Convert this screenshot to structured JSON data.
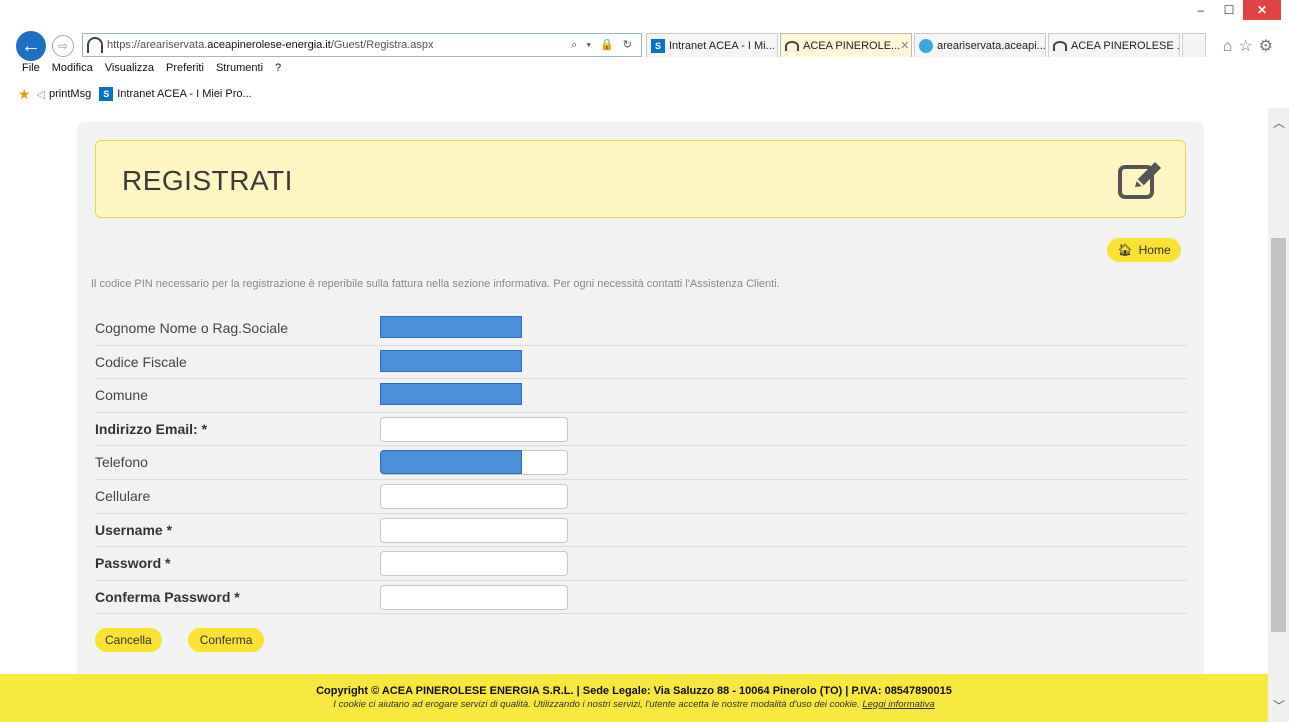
{
  "browser": {
    "url_prefix": "https://areariservata.",
    "url_domain": "aceapinerolese-energia.it",
    "url_path": "/Guest/Registra.aspx",
    "address_tools": "⌕ ▾ 🔒 ↻",
    "tabs": [
      {
        "label": "Intranet ACEA - I Mi...",
        "icon": "sharepoint-icon",
        "active": false
      },
      {
        "label": "ACEA PINEROLE...",
        "icon": "acea-icon",
        "active": true
      },
      {
        "label": "areariservata.aceapi...",
        "icon": "ie-icon",
        "active": false
      },
      {
        "label": "ACEA PINEROLESE ...",
        "icon": "acea-icon",
        "active": false
      }
    ],
    "menu": [
      "File",
      "Modifica",
      "Visualizza",
      "Preferiti",
      "Strumenti",
      "?"
    ],
    "favorites": [
      "printMsg",
      "Intranet ACEA - I Miei Pro..."
    ]
  },
  "page": {
    "title": "REGISTRATI",
    "home_label": "Home",
    "info": "Il codice PIN necessario per la registrazione è reperibile sulla fattura nella sezione informativa. Per ogni necessità contatti l'Assistenza Clienti.",
    "fields": {
      "cognome": "Cognome Nome o Rag.Sociale",
      "codice_fiscale": "Codice Fiscale",
      "comune": "Comune",
      "email": "Indirizzo Email: *",
      "telefono": "Telefono",
      "cellulare": "Cellulare",
      "username": "Username *",
      "password": "Password *",
      "conferma_password": "Conferma Password *"
    },
    "buttons": {
      "cancel": "Cancella",
      "confirm": "Conferma"
    }
  },
  "footer": {
    "copyright": "Copyright © ACEA PINEROLESE ENERGIA S.R.L.  | Sede Legale: Via Saluzzo 88 - 10064 Pinerolo (TO) | P.IVA: 08547890015",
    "cookie_text": "I cookie ci aiutano ad erogare servizi di qualità. Utilizzando i nostri servizi, l'utente accetta le nostre modalità d'uso dei cookie.",
    "cookie_link": "Leggi informativa"
  },
  "colors": {
    "accent_yellow": "#f9e234",
    "header_bg": "#fdf6c3",
    "redaction_blue": "#4d8fd8"
  }
}
